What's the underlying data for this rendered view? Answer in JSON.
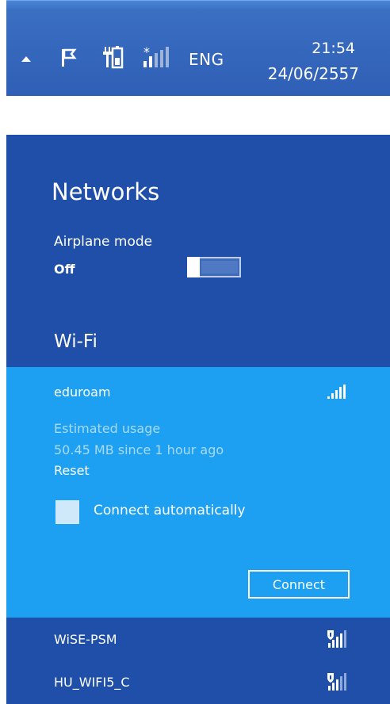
{
  "taskbar": {
    "language": "ENG",
    "time": "21:54",
    "date": "24/06/2557",
    "icons": [
      "up-arrow-icon",
      "action-center-flag-icon",
      "battery-power-icon",
      "network-signal-icon"
    ]
  },
  "networks_panel": {
    "title": "Networks",
    "airplane_mode": {
      "label": "Airplane mode",
      "state": "Off",
      "on": false
    },
    "wifi_heading": "Wi-Fi",
    "selected_network": {
      "ssid": "eduroam",
      "signal_bars": 5,
      "usage_label": "Estimated usage",
      "usage_value": "50.45 MB since 1 hour ago",
      "reset_label": "Reset",
      "auto_connect_label": "Connect automatically",
      "auto_connect_checked": false,
      "connect_label": "Connect"
    },
    "other_networks": [
      {
        "ssid": "WiSE-PSM",
        "secured": true,
        "signal_bars": 4
      },
      {
        "ssid": "HU_WIFI5_C",
        "secured": true,
        "signal_bars": 3
      }
    ]
  },
  "colors": {
    "panel_bg": "#1f4fa8",
    "selected_bg": "#1da0f2",
    "taskbar_bg": "#3a6fc2"
  }
}
